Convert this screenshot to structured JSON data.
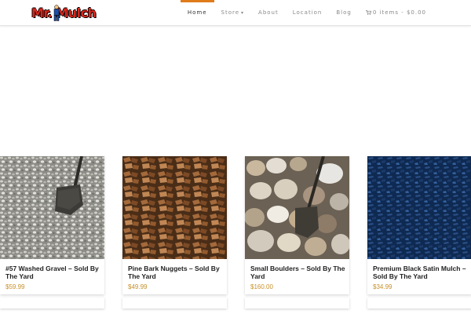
{
  "brand": {
    "logo_text": "Mr. Mulch"
  },
  "nav": {
    "items": [
      {
        "label": "Home",
        "active": true
      },
      {
        "label": "Store",
        "has_dropdown": true
      },
      {
        "label": "About"
      },
      {
        "label": "Location"
      },
      {
        "label": "Blog"
      }
    ],
    "cart": {
      "label": "0 items - $0.00"
    }
  },
  "products": [
    {
      "title": "#57 Washed Gravel – Sold By The Yard",
      "price": "$59.99",
      "image": "gravel-with-shovel"
    },
    {
      "title": "Pine Bark Nuggets – Sold By The Yard",
      "price": "$49.99",
      "image": "pine-bark-nuggets"
    },
    {
      "title": "Small Boulders – Sold By The Yard",
      "price": "$160.00",
      "image": "small-boulders-with-shovel"
    },
    {
      "title": "Premium Black Satin Mulch – Sold By The Yard",
      "price": "$34.99",
      "image": "black-satin-mulch"
    }
  ],
  "colors": {
    "accent": "#e07b1a",
    "price": "#c8902a",
    "logo_red": "#d8261c"
  }
}
